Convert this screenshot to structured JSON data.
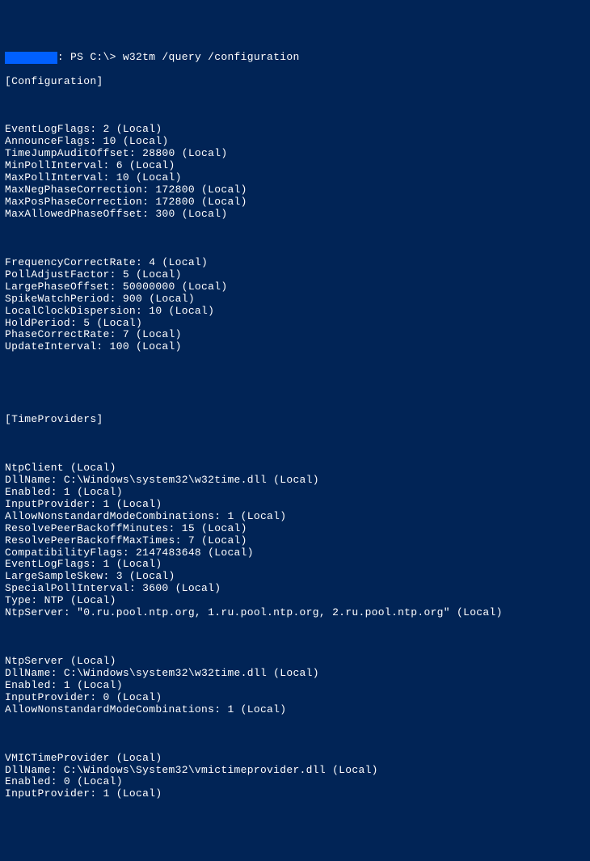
{
  "prompt": {
    "redacted": "XXXXXXXX",
    "suffix": ": PS C:\\> ",
    "command": "w32tm /query /configuration"
  },
  "sections": {
    "config_header": "[Configuration]",
    "config_lines": [
      "EventLogFlags: 2 (Local)",
      "AnnounceFlags: 10 (Local)",
      "TimeJumpAuditOffset: 28800 (Local)",
      "MinPollInterval: 6 (Local)",
      "MaxPollInterval: 10 (Local)",
      "MaxNegPhaseCorrection: 172800 (Local)",
      "MaxPosPhaseCorrection: 172800 (Local)",
      "MaxAllowedPhaseOffset: 300 (Local)"
    ],
    "config_lines2": [
      "FrequencyCorrectRate: 4 (Local)",
      "PollAdjustFactor: 5 (Local)",
      "LargePhaseOffset: 50000000 (Local)",
      "SpikeWatchPeriod: 900 (Local)",
      "LocalClockDispersion: 10 (Local)",
      "HoldPeriod: 5 (Local)",
      "PhaseCorrectRate: 7 (Local)",
      "UpdateInterval: 100 (Local)"
    ],
    "providers_header": "[TimeProviders]",
    "ntpclient_lines": [
      "NtpClient (Local)",
      "DllName: C:\\Windows\\system32\\w32time.dll (Local)",
      "Enabled: 1 (Local)",
      "InputProvider: 1 (Local)",
      "AllowNonstandardModeCombinations: 1 (Local)",
      "ResolvePeerBackoffMinutes: 15 (Local)",
      "ResolvePeerBackoffMaxTimes: 7 (Local)",
      "CompatibilityFlags: 2147483648 (Local)",
      "EventLogFlags: 1 (Local)",
      "LargeSampleSkew: 3 (Local)",
      "SpecialPollInterval: 3600 (Local)",
      "Type: NTP (Local)",
      "NtpServer: \"0.ru.pool.ntp.org, 1.ru.pool.ntp.org, 2.ru.pool.ntp.org\" (Local)"
    ],
    "ntpserver_lines": [
      "NtpServer (Local)",
      "DllName: C:\\Windows\\system32\\w32time.dll (Local)",
      "Enabled: 1 (Local)",
      "InputProvider: 0 (Local)",
      "AllowNonstandardModeCombinations: 1 (Local)"
    ],
    "vmic_lines": [
      "VMICTimeProvider (Local)",
      "DllName: C:\\Windows\\System32\\vmictimeprovider.dll (Local)",
      "Enabled: 0 (Local)",
      "InputProvider: 1 (Local)"
    ]
  }
}
